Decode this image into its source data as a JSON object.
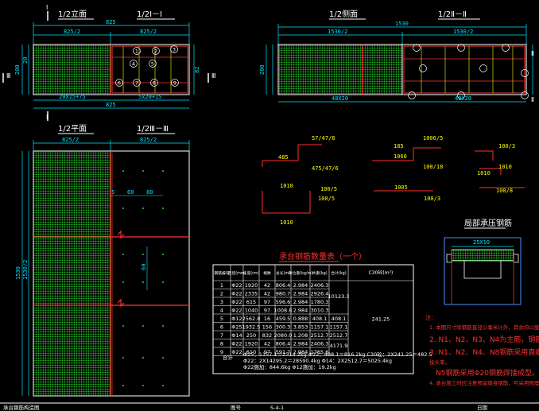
{
  "views": {
    "half_elev": "1/2立面",
    "sec1": "1/2Ⅰ－Ⅰ",
    "side": "1/2侧面",
    "sec2": "1/2Ⅱ－Ⅱ",
    "plan": "1/2平面",
    "sec3": "1/2Ⅲ－Ⅲ",
    "local": "局部承压钢筋",
    "table_title": "承台钢筋数量表（一个）"
  },
  "dims": {
    "d825": "825",
    "d825_2a": "825/2",
    "d825_2b": "825/2",
    "d20x15": "20X15+75",
    "d5x20": "5x20+15",
    "d825b": "825",
    "d1530": "1530",
    "d1530_2a": "1530/2",
    "d1530_2b": "1530/2",
    "d48x20a": "48X20",
    "d48x20b": "48X20",
    "p825_2a": "825/2",
    "p825_2b": "825/2",
    "d1530v": "1530",
    "d1530_2v": "1530/2",
    "d200": "200",
    "d20": "20",
    "d82": "82",
    "d5": "5",
    "d60": "60",
    "d80": "80",
    "d60b": "60",
    "d25x10": "25X10",
    "w1010": "1010",
    "w1010b": "1010",
    "w1010c": "1010",
    "w185": "185",
    "w1005": "100/5",
    "s1": "57/47/8",
    "s2": "475/47/6",
    "s3": "485",
    "s4": "1006/5",
    "s5": "1060",
    "s6": "100/18",
    "s7": "100/3",
    "s8": "1010",
    "s9": "100/8",
    "s10": "100/3",
    "s11": "1005",
    "s12": "100/5"
  },
  "marks": [
    "I",
    "I",
    "Ⅱ",
    "Ⅱ",
    "Ⅲ",
    "Ⅲ"
  ],
  "bubbles": [
    "1",
    "2",
    "3",
    "4",
    "5",
    "6",
    "7",
    "8",
    "9"
  ],
  "table": {
    "headers": [
      "钢筋编号",
      "直径(mm)",
      "长度(cm)",
      "根数",
      "总长(m)",
      "单位重(kg/m)",
      "共重(kg)",
      "合计(kg)",
      "C30砼(m³)"
    ],
    "rows": [
      [
        "1",
        "Φ22",
        "1920",
        "42",
        "806.4",
        "2.984",
        "2406.3"
      ],
      [
        "2",
        "Φ22",
        "2335",
        "42",
        "980.7",
        "2.984",
        "2926.4"
      ],
      [
        "3",
        "Φ22",
        "615",
        "97",
        "596.6",
        "2.984",
        "1780.3"
      ],
      [
        "4",
        "Φ22",
        "1040",
        "97",
        "1008.8",
        "2.984",
        "3010.3"
      ],
      [
        "5",
        "Φ12",
        "2562.8",
        "16",
        "459.5",
        "0.888",
        "408.1"
      ],
      [
        "6",
        "Φ25",
        "1932.5",
        "156",
        "300.3",
        "3.853",
        "1157.1"
      ],
      [
        "7",
        "Φ14",
        "250",
        "832",
        "2080.0",
        "1.208",
        "2512.7"
      ],
      [
        "8",
        "Φ22",
        "1920",
        "42",
        "806.4",
        "2.984",
        "2406.3"
      ],
      [
        "9",
        "Φ22",
        "610",
        "97",
        "591.7",
        "2.984",
        "1765.6"
      ]
    ],
    "sum1": "10123.3",
    "sum2": "408.1",
    "sum3": "1157.1",
    "sum4": "2512.7",
    "sum5": "4171.9",
    "conc": "241.25",
    "foot_label": "合计",
    "foot1": "Φ25：1157.1＝2314.2kg  Φ12：408.1＝816.2kg  C30砼：2X241.25＝482.5",
    "foot2": "Φ22：2X14295.2＝28590.4kg  Φ14：2X2512.7＝5025.4kg",
    "foot3": "Φ22施加：844.6kg  Φ12施加：19.2kg"
  },
  "notes": [
    "注：",
    "1. 本图尺寸除钢筋直径以毫米计外，其余均以厘米计。",
    "2. N1、N2、N3、N4为主筋，钢筋间距",
    "3. N1、N2、N4、N8钢筋采用直螺纹连接",
    "   接头率。",
    "   N5钢筋采用Φ20钢筋焊接成型。",
    "4. 承台施工时应注意预留墩身钢筋，可采用预埋钢筋。"
  ],
  "titlebar": {
    "t1": "承台钢筋构造图",
    "t2": "图号",
    "t3": "S-4-1",
    "t4": "日期"
  }
}
